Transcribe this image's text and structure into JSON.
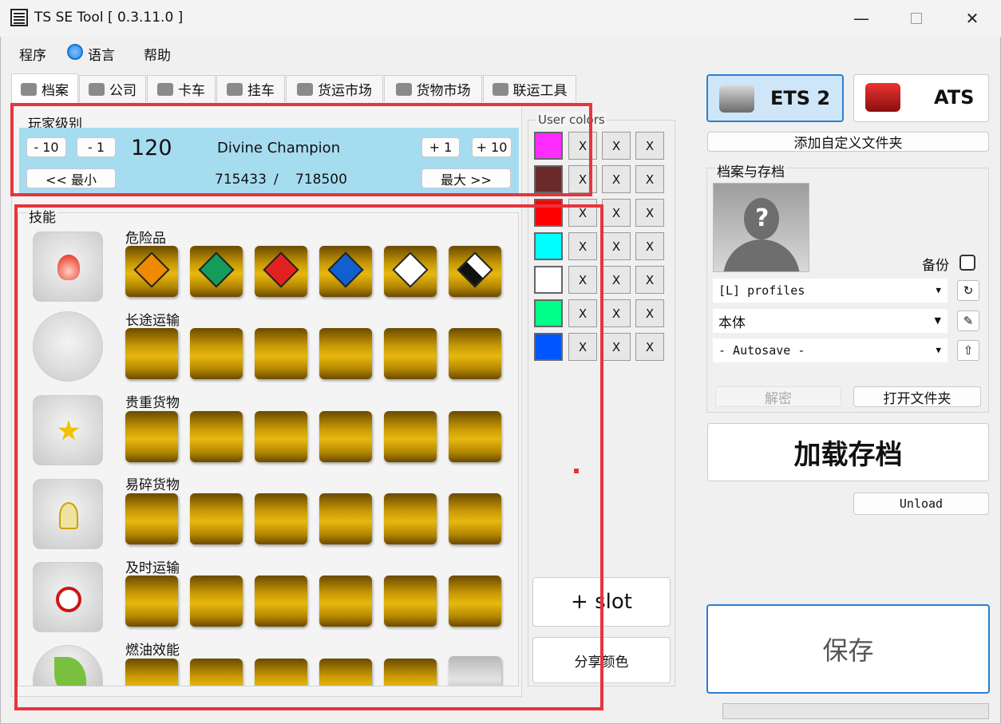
{
  "window": {
    "title": "TS SE Tool [ 0.3.11.0 ]",
    "minimize_icon": "minimize-icon",
    "maximize_icon": "maximize-icon",
    "close_icon": "close-icon"
  },
  "menu": {
    "items": [
      "程序",
      "语言",
      "帮助"
    ]
  },
  "tabs": [
    {
      "label": "档案",
      "icon": "profile-icon"
    },
    {
      "label": "公司",
      "icon": "company-icon"
    },
    {
      "label": "卡车",
      "icon": "truck-icon"
    },
    {
      "label": "挂车",
      "icon": "trailer-icon"
    },
    {
      "label": "货运市场",
      "icon": "freight-market-icon"
    },
    {
      "label": "货物市场",
      "icon": "cargo-market-icon"
    },
    {
      "label": "联运工具",
      "icon": "convoy-tools-icon"
    }
  ],
  "player_level": {
    "group_label": "玩家级别",
    "minus10": "- 10",
    "minus1": "- 1",
    "plus1": "+ 1",
    "plus10": "+ 10",
    "level": "120",
    "rank_name": "Divine Champion",
    "xp_current": "715433",
    "xp_sep": "/",
    "xp_max": "718500",
    "min_button": "<< 最小",
    "max_button": "最大 >>"
  },
  "skills": {
    "group_label": "技能",
    "rows": [
      {
        "label": "危险品",
        "icon": "adr-skill-icon",
        "adr_badges": [
          "EXPLOSIVES 1",
          "NON-FLAMMABLE GAS 2",
          "FLAMMABLE 3",
          "DANGEROUS WHEN WET 4",
          "TOXIC 6",
          "CORROSIVE 8"
        ]
      },
      {
        "label": "长途运输",
        "icon": "long-distance-icon"
      },
      {
        "label": "贵重货物",
        "icon": "high-value-cargo-icon"
      },
      {
        "label": "易碎货物",
        "icon": "fragile-cargo-icon"
      },
      {
        "label": "及时运输",
        "icon": "just-in-time-icon"
      },
      {
        "label": "燃油效能",
        "icon": "eco-driving-icon"
      }
    ]
  },
  "user_colors": {
    "label": "User colors",
    "swatches": [
      "#ff2cff",
      "#6b2a2a",
      "#ff0000",
      "#00ffff",
      "#ffffff",
      "#00ff88",
      "#0055ff"
    ],
    "x_label": "X",
    "add_slot": "+ slot",
    "share_colors": "分享颜色"
  },
  "game_select": {
    "ets2": "ETS 2",
    "ats": "ATS"
  },
  "add_custom_folder": "添加自定义文件夹",
  "profiles_saves": {
    "group_label": "档案与存档",
    "backup_label": "备份",
    "profiles_combo": "[L] profiles",
    "profile_combo": "本体",
    "save_combo": "- Autosave -",
    "decrypt": "解密",
    "open_folder": "打开文件夹"
  },
  "load_save": "加载存档",
  "unload": "Unload",
  "save": "保存",
  "colors": {
    "accent_blue": "#cfe6f8",
    "level_bg": "#a6dcef",
    "highlight_red": "#e8343d"
  }
}
